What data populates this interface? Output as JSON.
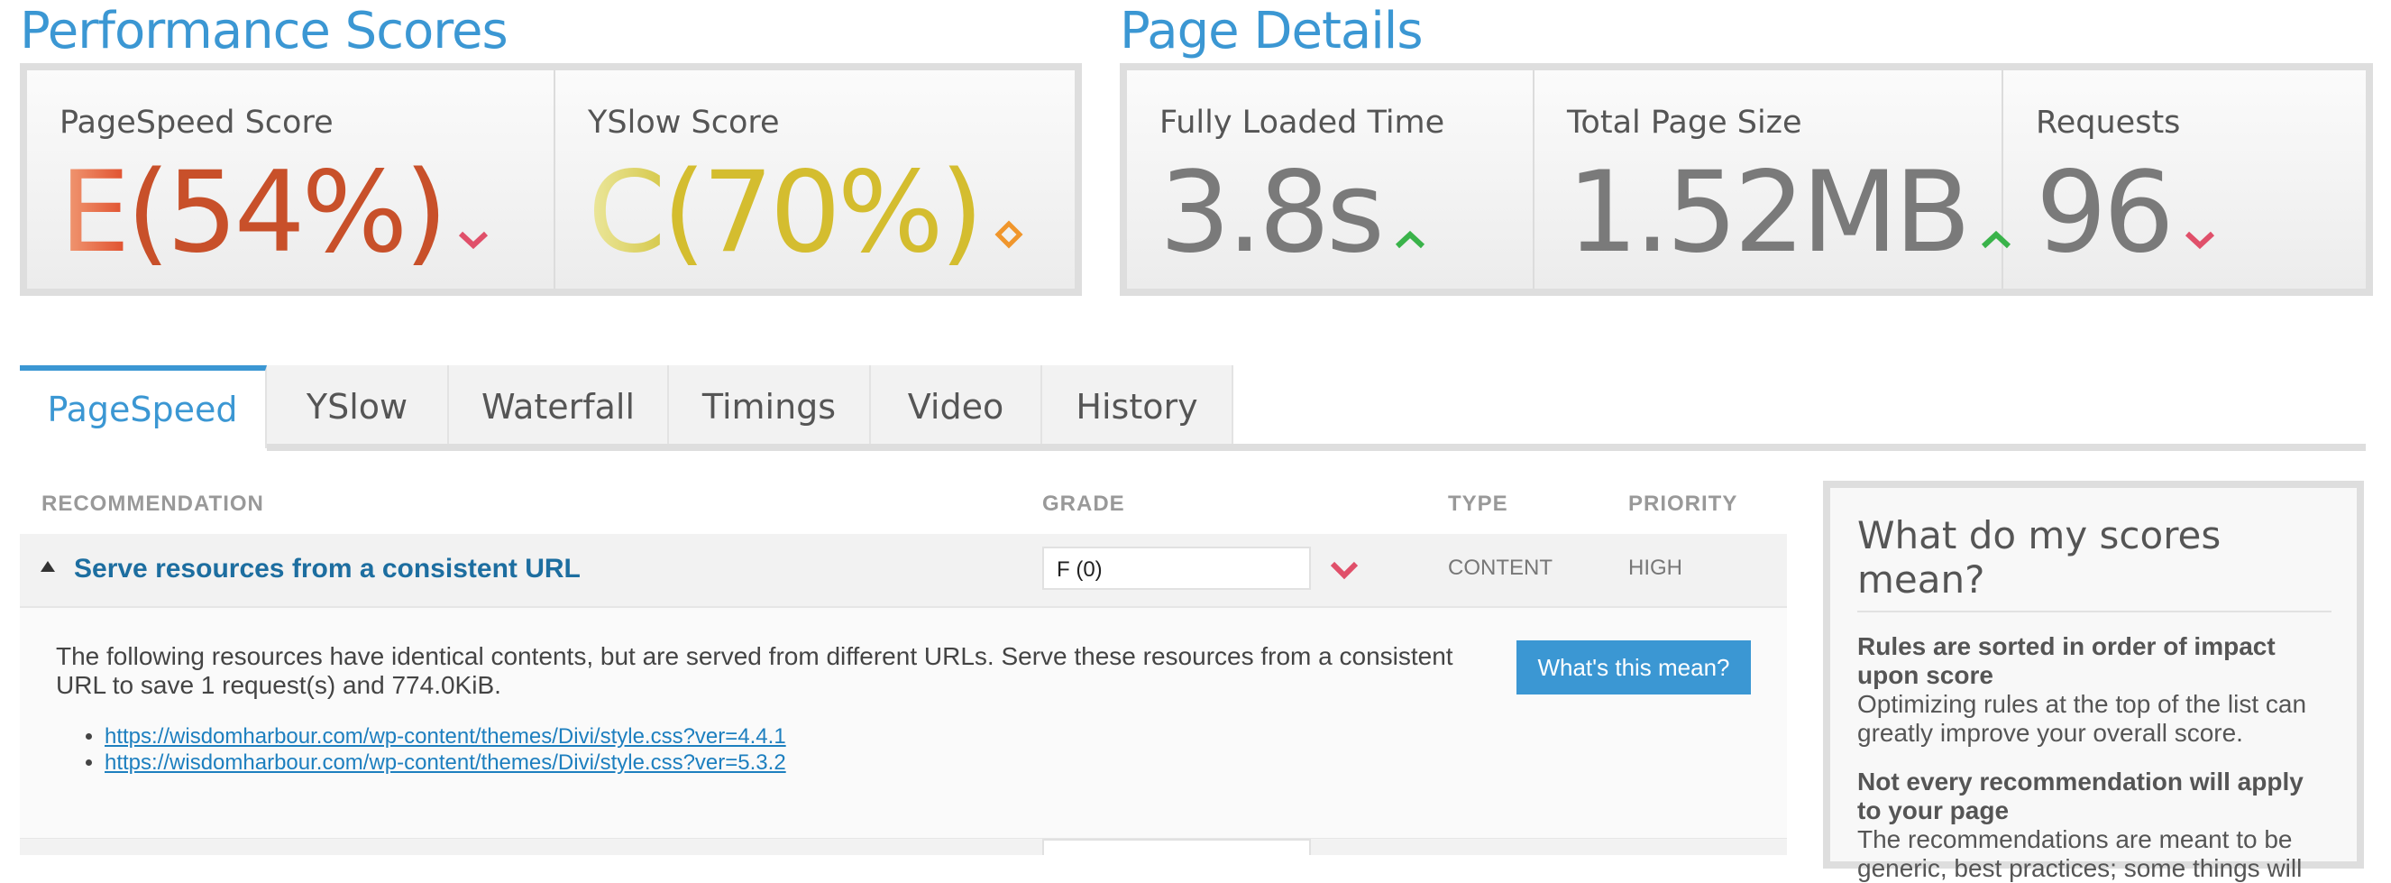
{
  "performance": {
    "title": "Performance Scores",
    "pagespeed": {
      "label": "PageSpeed Score",
      "grade": "E",
      "score": "(54%)",
      "trend": "down"
    },
    "yslow": {
      "label": "YSlow Score",
      "grade": "C",
      "score": "(70%)",
      "trend": "neutral"
    }
  },
  "details": {
    "title": "Page Details",
    "load_time": {
      "label": "Fully Loaded Time",
      "value": "3.8s",
      "trend": "up"
    },
    "page_size": {
      "label": "Total Page Size",
      "value": "1.52MB",
      "trend": "up"
    },
    "requests": {
      "label": "Requests",
      "value": "96",
      "trend": "down"
    }
  },
  "tabs": [
    "PageSpeed",
    "YSlow",
    "Waterfall",
    "Timings",
    "Video",
    "History"
  ],
  "active_tab": "PageSpeed",
  "table": {
    "headers": {
      "recommendation": "RECOMMENDATION",
      "grade": "GRADE",
      "type": "TYPE",
      "priority": "PRIORITY"
    },
    "rows": [
      {
        "title": "Serve resources from a consistent URL",
        "grade": "F (0)",
        "type": "CONTENT",
        "priority": "HIGH",
        "description": "The following resources have identical contents, but are served from different URLs. Serve these resources from a consistent URL to save 1 request(s) and 774.0KiB.",
        "button": "What's this mean?",
        "urls": [
          "https://wisdomharbour.com/wp-content/themes/Divi/style.css?ver=4.4.1",
          "https://wisdomharbour.com/wp-content/themes/Divi/style.css?ver=5.3.2"
        ]
      }
    ]
  },
  "sidebar": {
    "title": "What do my scores mean?",
    "items": [
      {
        "heading": "Rules are sorted in order of impact upon score",
        "text": "Optimizing rules at the top of the list can greatly improve your overall score."
      },
      {
        "heading": "Not every recommendation will apply to your page",
        "text": "The recommendations are meant to be generic, best practices; some things will"
      }
    ]
  },
  "colors": {
    "accent": "#3b97d3",
    "down": "#e0506a",
    "up": "#3ab34a",
    "neutral": "#f0962c"
  }
}
